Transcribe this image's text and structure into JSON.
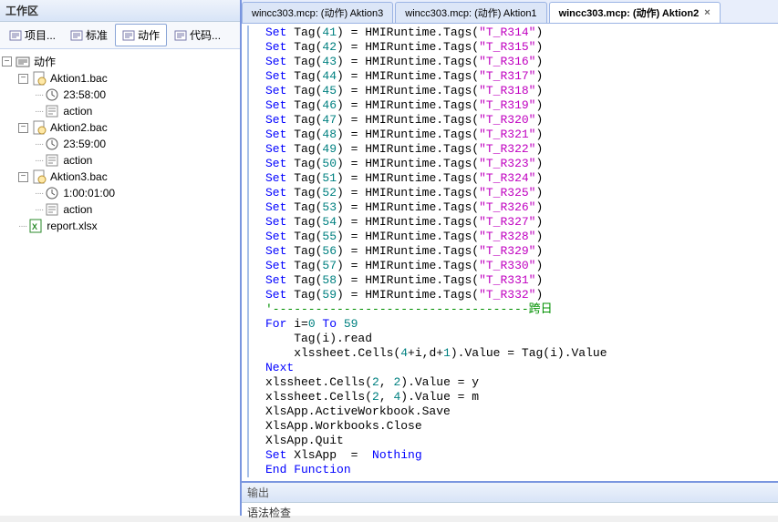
{
  "left": {
    "header": "工作区",
    "toolbar": [
      {
        "label": "项目...",
        "active": false
      },
      {
        "label": "标准",
        "active": false
      },
      {
        "label": "动作",
        "active": true
      },
      {
        "label": "代码...",
        "active": false
      }
    ],
    "tree_root": "动作",
    "nodes": [
      {
        "name": "Aktion1.bac",
        "time": "23:58:00",
        "action": "action"
      },
      {
        "name": "Aktion2.bac",
        "time": "23:59:00",
        "action": "action"
      },
      {
        "name": "Aktion3.bac",
        "time": "1:00:01:00",
        "action": "action"
      }
    ],
    "report": "report.xlsx"
  },
  "tabs": [
    {
      "label": "wincc303.mcp: (动作) Aktion3",
      "active": false
    },
    {
      "label": "wincc303.mcp: (动作) Aktion1",
      "active": false
    },
    {
      "label": "wincc303.mcp: (动作) Aktion2",
      "active": true
    }
  ],
  "code_tags": [
    {
      "idx": 41,
      "tag": "T_R314"
    },
    {
      "idx": 42,
      "tag": "T_R315"
    },
    {
      "idx": 43,
      "tag": "T_R316"
    },
    {
      "idx": 44,
      "tag": "T_R317"
    },
    {
      "idx": 45,
      "tag": "T_R318"
    },
    {
      "idx": 46,
      "tag": "T_R319"
    },
    {
      "idx": 47,
      "tag": "T_R320"
    },
    {
      "idx": 48,
      "tag": "T_R321"
    },
    {
      "idx": 49,
      "tag": "T_R322"
    },
    {
      "idx": 50,
      "tag": "T_R323"
    },
    {
      "idx": 51,
      "tag": "T_R324"
    },
    {
      "idx": 52,
      "tag": "T_R325"
    },
    {
      "idx": 53,
      "tag": "T_R326"
    },
    {
      "idx": 54,
      "tag": "T_R327"
    },
    {
      "idx": 55,
      "tag": "T_R328"
    },
    {
      "idx": 56,
      "tag": "T_R329"
    },
    {
      "idx": 57,
      "tag": "T_R330"
    },
    {
      "idx": 58,
      "tag": "T_R331"
    },
    {
      "idx": 59,
      "tag": "T_R332"
    }
  ],
  "code_tail": {
    "comment": "'------------------------------------跨日",
    "for_i": "i=",
    "for_start": "0",
    "for_to": " To ",
    "for_end": "59",
    "read": "    Tag(i).read",
    "cells4": "    xlssheet.Cells(",
    "cells4_a": "4",
    "cells4_mid": "+i,d+",
    "cells4_b": "1",
    "cells4_end": ").Value = Tag(i).Value",
    "next": "Next",
    "sheet2a": "xlssheet.Cells(",
    "two": "2",
    "comma": ", ",
    "paren_val_y": ").Value = y",
    "four": "4",
    "paren_val_m": ").Value = m",
    "save": "XlsApp.ActiveWorkbook.Save",
    "close": "XlsApp.Workbooks.Close",
    "quit": "XlsApp.Quit",
    "set_nothing_a": " XlsApp  =  ",
    "nothing": "Nothing",
    "endfn": "End Function"
  },
  "output": {
    "header": "输出",
    "body": "语法检查"
  }
}
